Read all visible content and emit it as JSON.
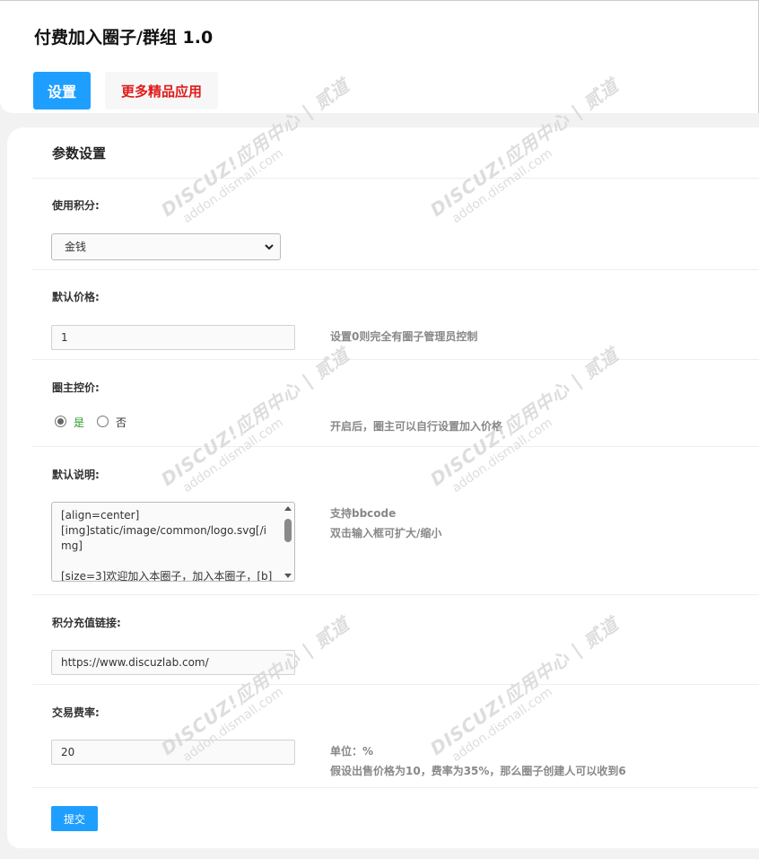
{
  "app": {
    "title": "付费加入圈子/群组 1.0"
  },
  "tabs": {
    "settings": "设置",
    "more_apps": "更多精品应用"
  },
  "section": {
    "title": "参数设置"
  },
  "fields": {
    "credit": {
      "label": "使用积分:",
      "selected": "金钱"
    },
    "default_price": {
      "label": "默认价格:",
      "value": "1",
      "hint": "设置0则完全有圈子管理员控制"
    },
    "owner_price": {
      "label": "圈主控价:",
      "options": [
        "是",
        "否"
      ],
      "selected": "是",
      "hint": "开启后，圈主可以自行设置加入价格"
    },
    "default_desc": {
      "label": "默认说明:",
      "value": "[align=center]\n[img]static/image/common/logo.svg[/img]\n\n[size=3]欢迎加入本圈子，加入本圈子，[b]",
      "hint1": "支持bbcode",
      "hint2": "双击输入框可扩大/缩小"
    },
    "recharge_link": {
      "label": "积分充值链接:",
      "value": "https://www.discuzlab.com/"
    },
    "fee_rate": {
      "label": "交易费率:",
      "value": "20",
      "hint1": "单位：%",
      "hint2": "假设出售价格为10，费率为35%，那么圈子创建人可以收到6"
    }
  },
  "submit": {
    "label": "提交"
  },
  "watermark": {
    "line1": "DISCUZ!应用中心 | 贰道",
    "line2": "addon.dismall.com"
  },
  "colors": {
    "primary": "#1e9fff",
    "more_apps_text": "#e01b1b",
    "radio_yes": "#2a9d2a"
  }
}
